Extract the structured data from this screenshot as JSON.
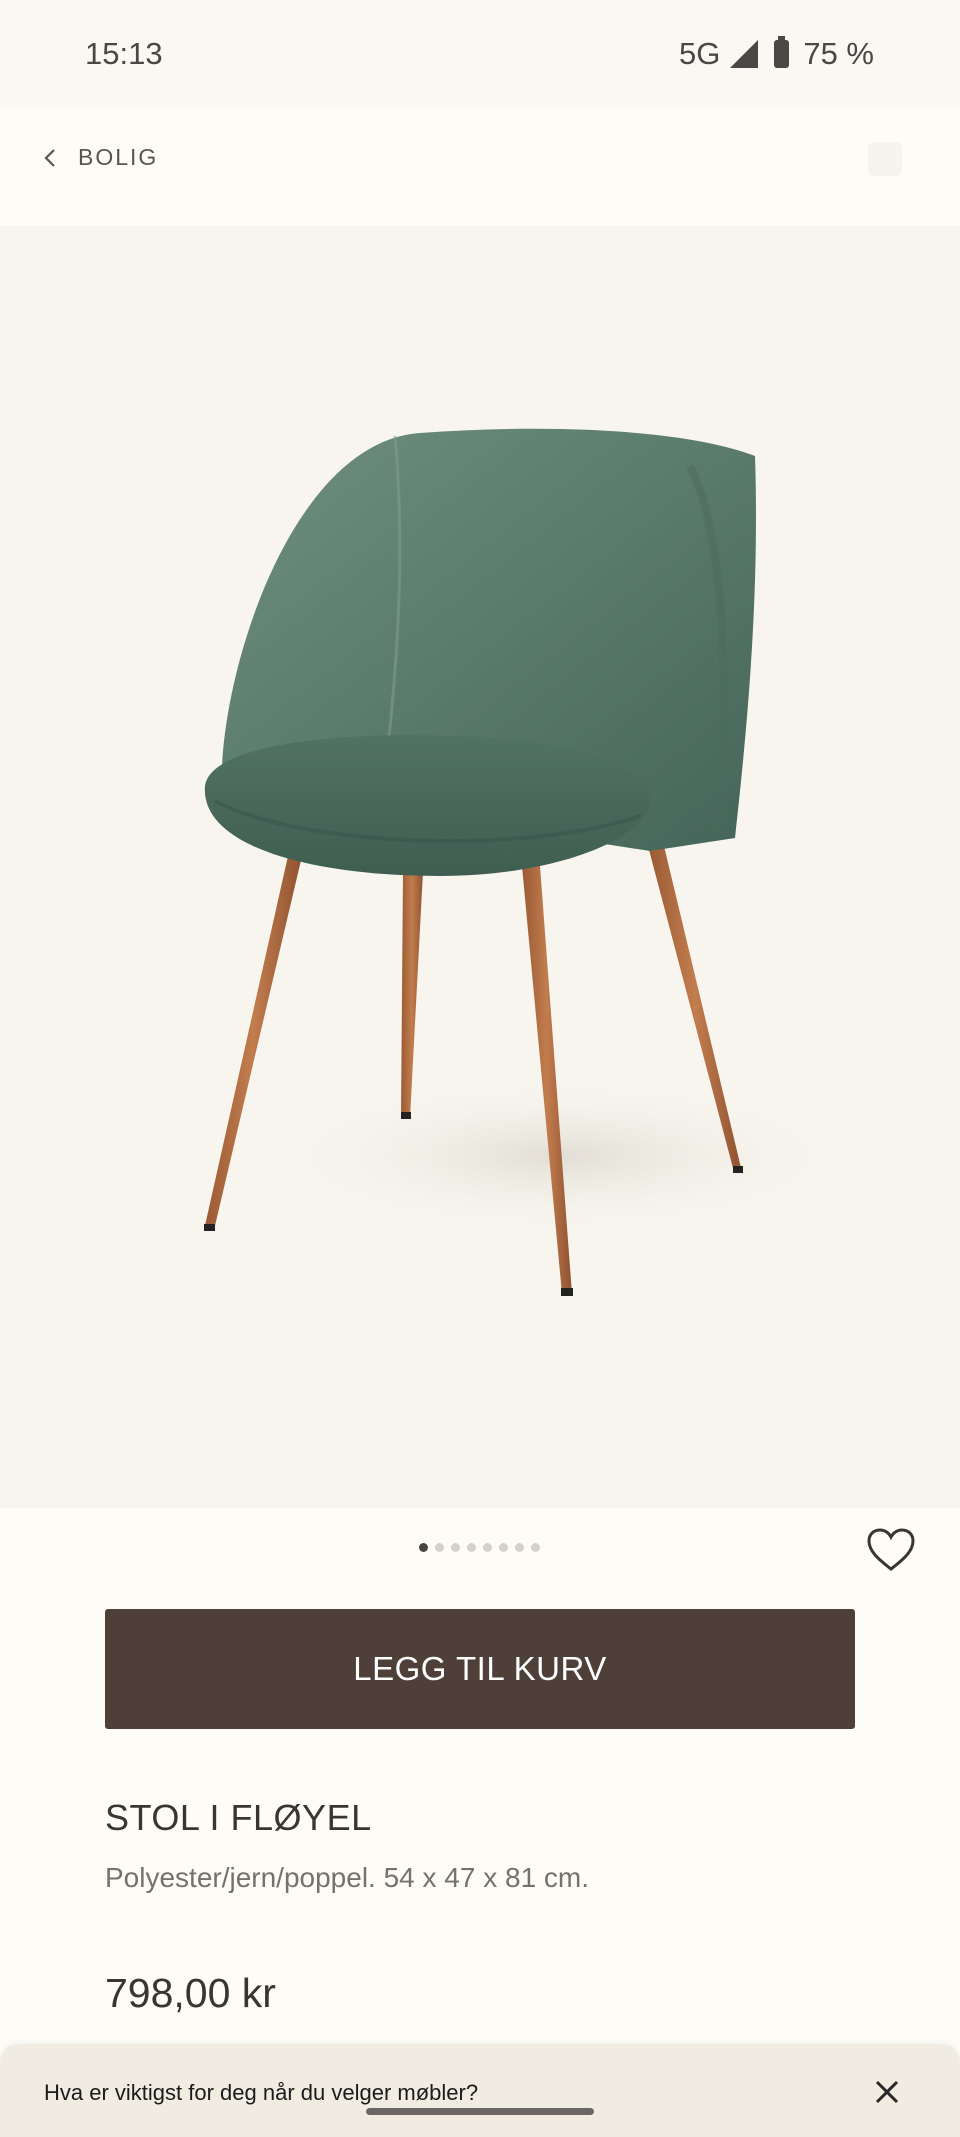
{
  "status_bar": {
    "time": "15:13",
    "network": "5G",
    "battery": "75 %",
    "icons": [
      "signal-icon",
      "battery-icon"
    ]
  },
  "header": {
    "back_label": "BOLIG",
    "back_icon": "chevron-left-icon"
  },
  "gallery": {
    "image_count": 8,
    "active_index": 0
  },
  "favorite_icon": "heart-icon",
  "cart_button_label": "LEGG TIL KURV",
  "product": {
    "title": "STOL I FLØYEL",
    "description": "Polyester/jern/poppel. 54 x 47 x 81 cm.",
    "price": "798,00 kr"
  },
  "survey": {
    "question": "Hva er viktigst for deg når du velger møbler?",
    "close_icon": "close-icon"
  },
  "colors": {
    "background": "#fdfcf7",
    "button": "#4e4039",
    "chair_velvet": "#5d7d6e",
    "chair_legs": "#b06a3f"
  }
}
